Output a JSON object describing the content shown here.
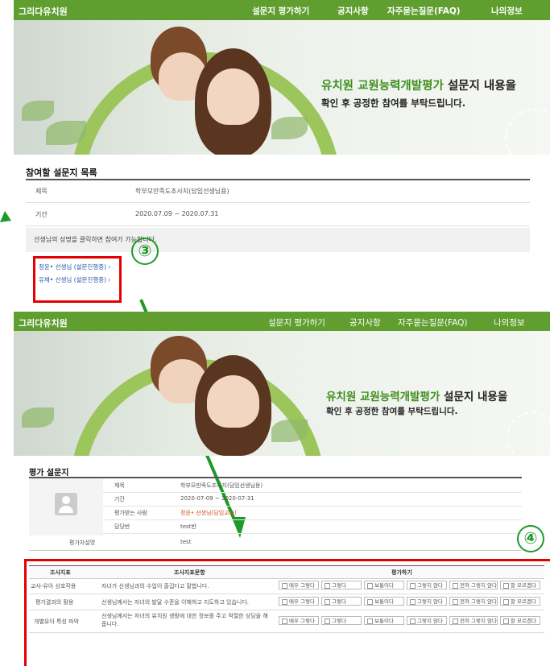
{
  "app_name": "그리다유치원",
  "menu": [
    "설문지 평가하기",
    "공지사항",
    "자주묻는질문(FAQ)",
    "나의정보"
  ],
  "hero": {
    "highlight": "유치원 교원능력개발평가",
    "title_rest": " 설문지 내용을",
    "subtitle": "확인 후 공정한 참여를 부탁드립니다."
  },
  "survey_list": {
    "heading": "참여할 설문지 목록",
    "rows": [
      {
        "label": "제목",
        "value": "학부모만족도조사지(담임선생님용)"
      },
      {
        "label": "기간",
        "value": "2020.07.09 ~ 2020.07.31"
      }
    ],
    "note": "선생님의 성명을 클릭하면 참여가 가능합니다.",
    "links": [
      "정윤• 선생님 (설문진행중) ›",
      "유채• 선생님 (설문진행중) ›"
    ]
  },
  "step_numbers": [
    "③",
    "④"
  ],
  "eval": {
    "heading": "평가 설문지",
    "rows": [
      {
        "label": "제목",
        "value": "학부모만족도조사지(담임선생님용)"
      },
      {
        "label": "기간",
        "value": "2020-07-09 ~ 2020-07-31"
      },
      {
        "label": "평가받는 사람",
        "value": "정윤• 선생님(담임교사)"
      },
      {
        "label": "담당반",
        "value": "test반"
      }
    ],
    "evaluator_label": "평가자설명",
    "evaluator_value": "test",
    "table": {
      "headers": [
        "조사지표",
        "조사지표문항",
        "평가하기"
      ],
      "rows": [
        {
          "indicator": "교사-유아 상호작용",
          "question": "자녀가 선생님과의 수업이 즐겁다고 말합니다."
        },
        {
          "indicator": "평가결과의 활용",
          "question": "선생님께서는 자녀의 발달 수준을 이해하고 지도하고 있습니다."
        },
        {
          "indicator": "개별유아 특성 파악",
          "question": "선생님께서는 자녀의 유치원 생활에 대한 정보를 주고 적절한 상담을 해 줍니다."
        }
      ],
      "options": [
        "매우 그렇다",
        "그렇다",
        "보통이다",
        "그렇지 않다",
        "전혀 그렇지 않다",
        "잘 모르겠다"
      ]
    }
  }
}
